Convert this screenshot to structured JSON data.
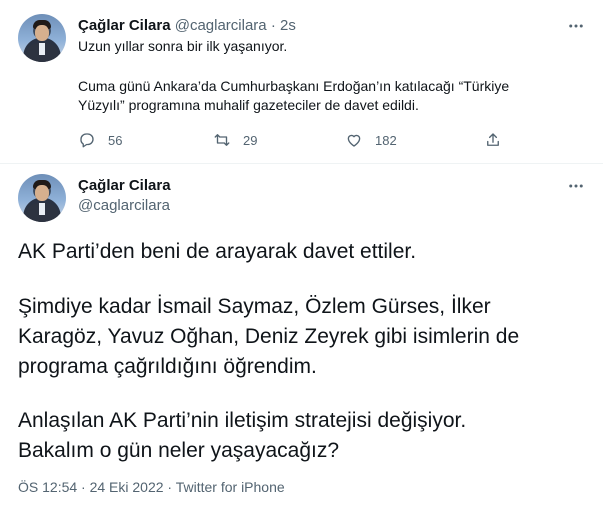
{
  "tweet1": {
    "name": "Çağlar Cilara",
    "handle": "@caglarcilara",
    "separator": "·",
    "time": "2s",
    "line1": "Uzun yıllar sonra bir ilk yaşanıyor.",
    "line2": "Cuma günü Ankara’da Cumhurbaşkanı Erdoğan’ın katılacağı “Türkiye",
    "line3": "Yüzyılı” programına muhalif gazeteciler de davet edildi.",
    "actions": {
      "reply_count": "56",
      "retweet_count": "29",
      "like_count": "182"
    }
  },
  "tweet2": {
    "name": "Çağlar Cilara",
    "handle": "@caglarcilara",
    "lines": [
      "AK Parti’den beni de arayarak davet ettiler.",
      "Şimdiye kadar İsmail Saymaz, Özlem Gürses, İlker",
      "Karagöz, Yavuz Oğhan, Deniz Zeyrek gibi isimlerin de",
      "programa çağrıldığını öğrendim.",
      "Anlaşılan AK Parti’nin iletişim stratejisi değişiyor.",
      "Bakalım o gün neler yaşayacağız?"
    ],
    "meta": "ÖS 12:54 · 24 Eki 2022 · Twitter for iPhone"
  },
  "icons": {
    "reply": "comment-icon",
    "retweet": "retweet-icon",
    "like": "heart-icon",
    "share": "share-icon",
    "more": "more-dots-icon"
  },
  "colors": {
    "text": "#0f1419",
    "secondary": "#536471",
    "divider": "#eff3f4"
  }
}
